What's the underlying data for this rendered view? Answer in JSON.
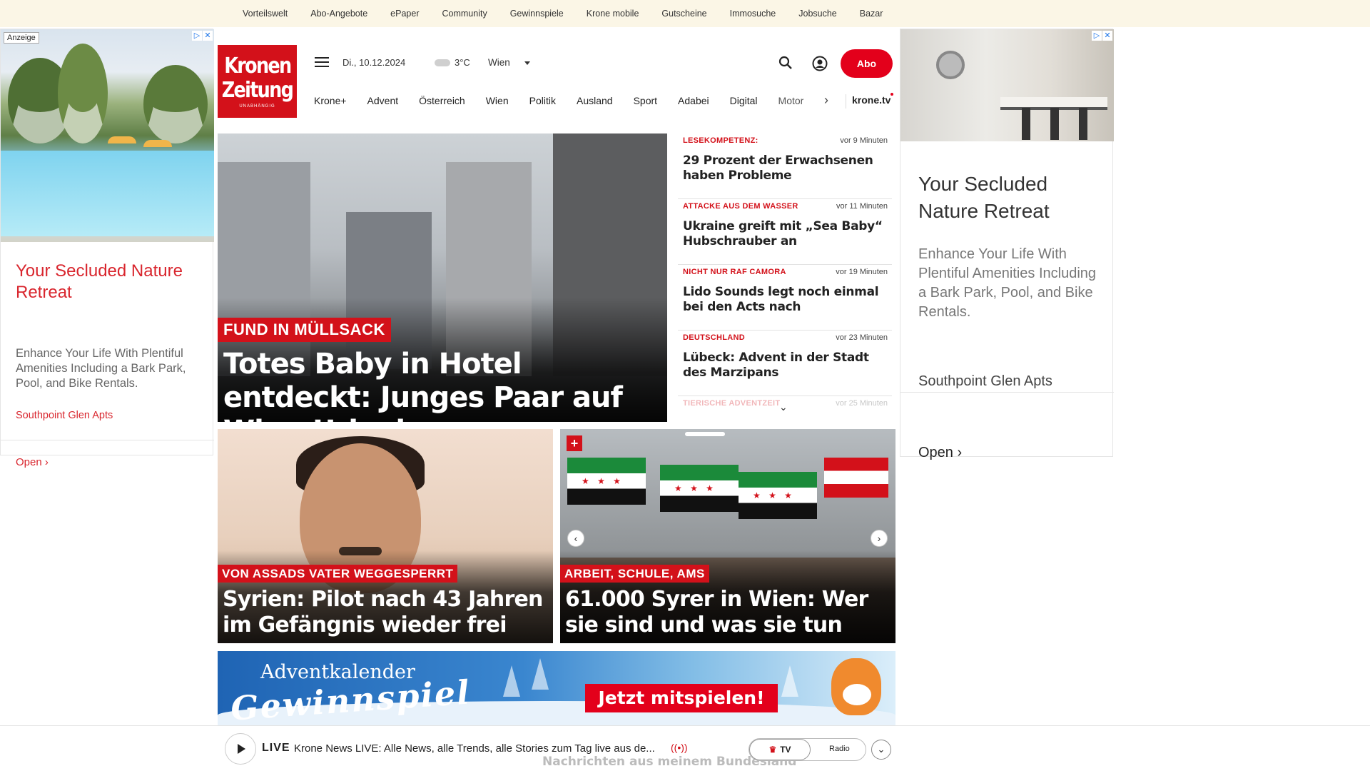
{
  "topbar": {
    "links": [
      "Vorteilswelt",
      "Abo-Angebote",
      "ePaper",
      "Community",
      "Gewinnspiele",
      "Krone mobile",
      "Gutscheine",
      "Immosuche",
      "Jobsuche",
      "Bazar"
    ]
  },
  "ads": {
    "label": "Anzeige",
    "left": {
      "title": "Your Secluded Nature Retreat",
      "description": "Enhance Your Life With Plentiful Amenities Including a Bark Park, Pool, and Bike Rentals.",
      "advertiser": "Southpoint Glen Apts",
      "cta": "Open"
    },
    "right": {
      "title": "Your Secluded Nature Retreat",
      "description": "Enhance Your Life With Plentiful Amenities Including a Bark Park, Pool, and Bike Rentals.",
      "advertiser": "Southpoint Glen Apts",
      "cta": "Open"
    }
  },
  "header": {
    "logo_line1": "Kronen",
    "logo_line2": "Zeitung",
    "logo_tagline": "UNABHÄNGIG",
    "date": "Di., 10.12.2024",
    "temperature": "3°C",
    "city": "Wien",
    "abo_label": "Abo"
  },
  "nav": {
    "items": [
      "Krone+",
      "Advent",
      "Österreich",
      "Wien",
      "Politik",
      "Ausland",
      "Sport",
      "Adabei",
      "Digital",
      "Motor"
    ],
    "tv_label": "krone.tv"
  },
  "hero": {
    "kicker": "FUND IN MÜLLSACK",
    "headline": "Totes Baby in Hotel entdeckt: Junges Paar auf Wien-Urlaub"
  },
  "newslist": [
    {
      "category": "LESEKOMPETENZ:",
      "time": "vor 9 Minuten",
      "title": "29 Prozent der Erwachsenen haben Probleme"
    },
    {
      "category": "ATTACKE AUS DEM WASSER",
      "time": "vor 11 Minuten",
      "title": "Ukraine greift mit „Sea Baby“ Hubschrauber an"
    },
    {
      "category": "NICHT NUR RAF CAMORA",
      "time": "vor 19 Minuten",
      "title": "Lido Sounds legt noch einmal bei den Acts nach"
    },
    {
      "category": "DEUTSCHLAND",
      "time": "vor 23 Minuten",
      "title": "Lübeck: Advent in der Stadt des Marzipans"
    },
    {
      "category": "TIERISCHE ADVENTZEIT",
      "time": "vor 25 Minuten",
      "title": ""
    }
  ],
  "teasers": [
    {
      "kicker": "VON ASSADS VATER WEGGESPERRT",
      "headline": "Syrien: Pilot nach 43 Jahren im Gefängnis wieder frei"
    },
    {
      "kicker": "ARBEIT, SCHULE, AMS",
      "headline": "61.000 Syrer in Wien: Wer sie sind und was sie tun"
    }
  ],
  "advent": {
    "line1": "Adventkalender",
    "line2": "Gewinnspiel",
    "cta": "Jetzt mitspielen!"
  },
  "player": {
    "live_label": "LIVE",
    "text": "Krone News LIVE: Alle News, alle Trends, alle Stories zum Tag live aus de...",
    "tv_label": "TV",
    "radio_label": "Radio",
    "below_text": "Nachrichten aus meinem Bundesland"
  }
}
